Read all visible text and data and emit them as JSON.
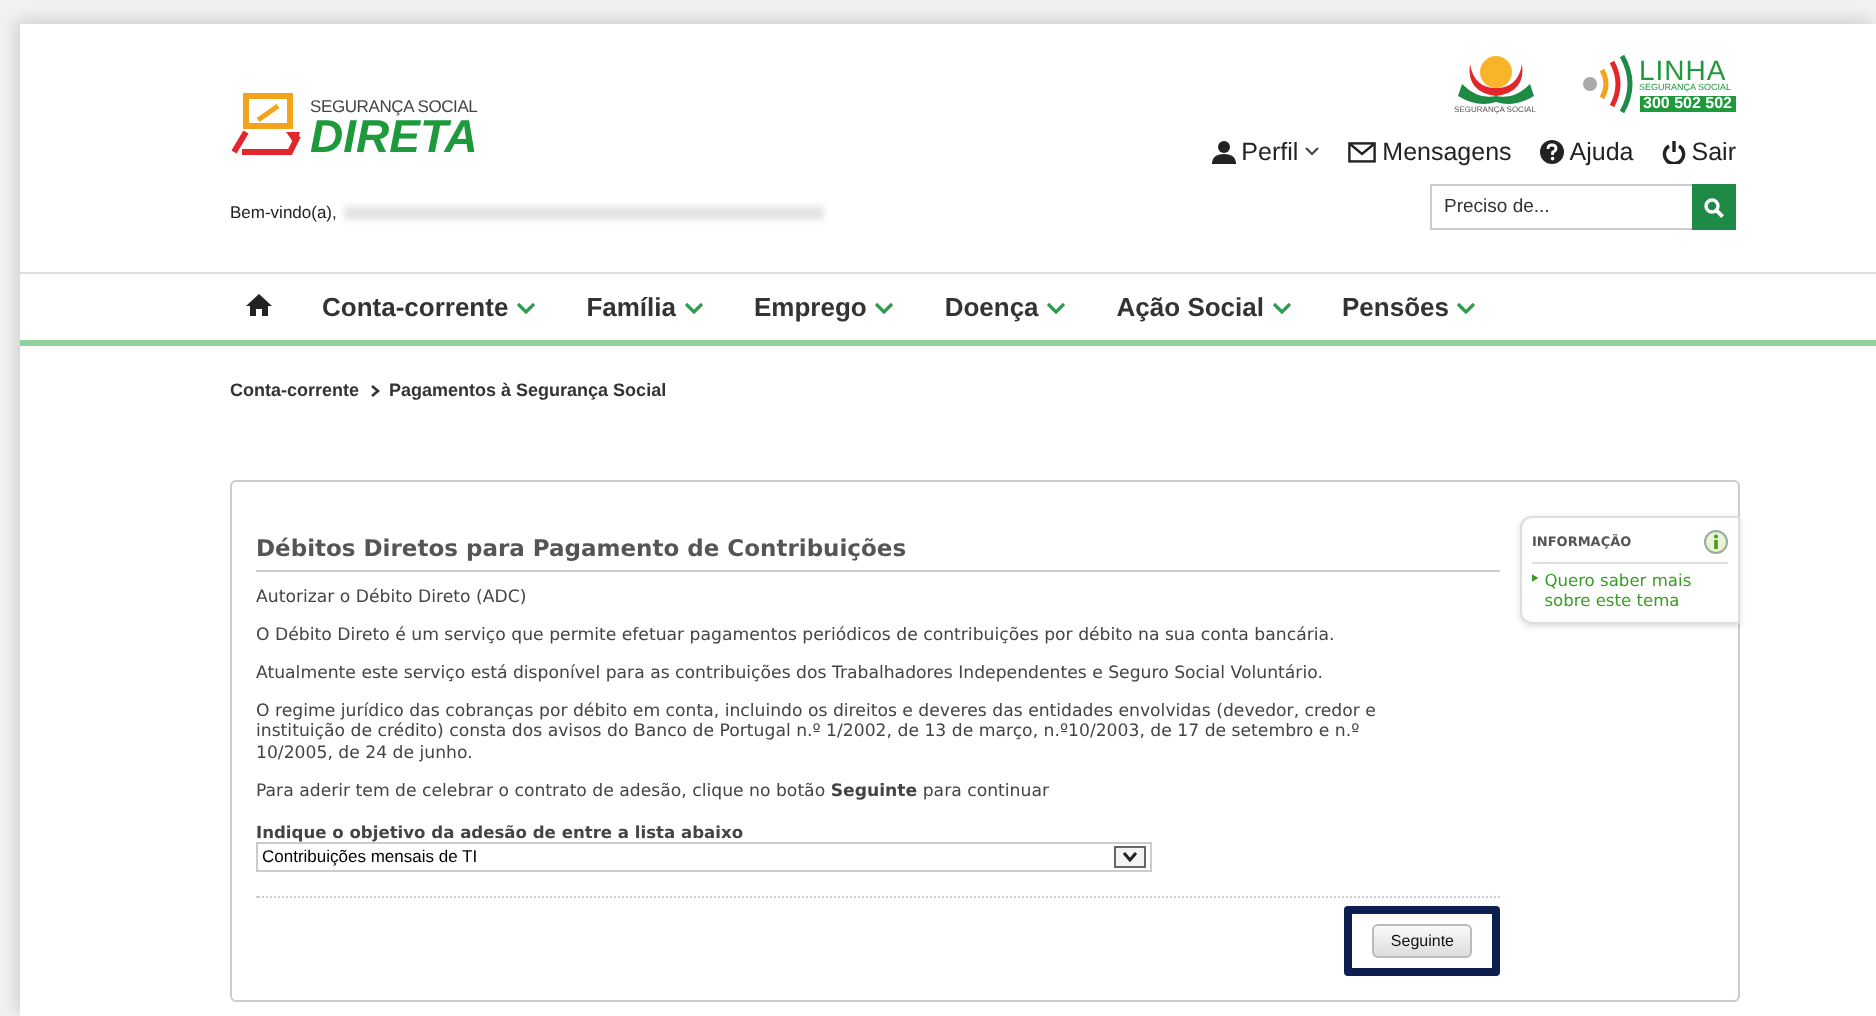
{
  "header": {
    "logo": {
      "top": "SEGURANÇA SOCIAL",
      "main": "DIRETA"
    },
    "greeting": "Bem-vindo(a),",
    "seal": {
      "caption": "SEGURANÇA SOCIAL"
    },
    "hotline": {
      "title": "LINHA",
      "subtitle": "SEGURANÇA SOCIAL",
      "number": "300 502 502"
    },
    "user_links": [
      {
        "kind": "user",
        "label": "Perfil",
        "dropdown": true
      },
      {
        "kind": "mail",
        "label": "Mensagens",
        "dropdown": false
      },
      {
        "kind": "help",
        "label": "Ajuda",
        "dropdown": false
      },
      {
        "kind": "power",
        "label": "Sair",
        "dropdown": false
      }
    ],
    "search": {
      "placeholder": "Preciso de..."
    }
  },
  "nav": {
    "items": [
      {
        "label": "Conta-corrente"
      },
      {
        "label": "Família"
      },
      {
        "label": "Emprego"
      },
      {
        "label": "Doença"
      },
      {
        "label": "Ação Social"
      },
      {
        "label": "Pensões"
      }
    ]
  },
  "breadcrumb": [
    "Conta-corrente",
    "Pagamentos à Segurança Social"
  ],
  "panel": {
    "title": "Débitos Diretos para Pagamento de Contribuições",
    "paragraphs": [
      "Autorizar o Débito Direto (ADC)",
      "O Débito Direto é um serviço que permite efetuar pagamentos periódicos de contribuições por débito na sua conta bancária.",
      "Atualmente este serviço está disponível para as contribuições dos Trabalhadores Independentes e Seguro Social Voluntário.",
      "O regime jurídico das cobranças por débito em conta, incluindo os direitos e deveres das entidades envolvidas (devedor, credor e instituição de crédito) consta dos avisos do Banco de Portugal n.º 1/2002, de 13 de março, n.º10/2003, de 17 de setembro e n.º 10/2005, de 24 de junho.",
      "Para aderir tem de celebrar o contrato de adesão, clique no botão **Seguinte** para continuar"
    ],
    "select": {
      "label": "Indique o objetivo da adesão de entre a lista abaixo",
      "value": "Contribuições mensais de TI"
    },
    "button": {
      "label": "Seguinte",
      "highlighted": true
    },
    "info": {
      "title": "INFORMAÇÃO",
      "link": "Quero saber mais sobre este tema"
    }
  }
}
